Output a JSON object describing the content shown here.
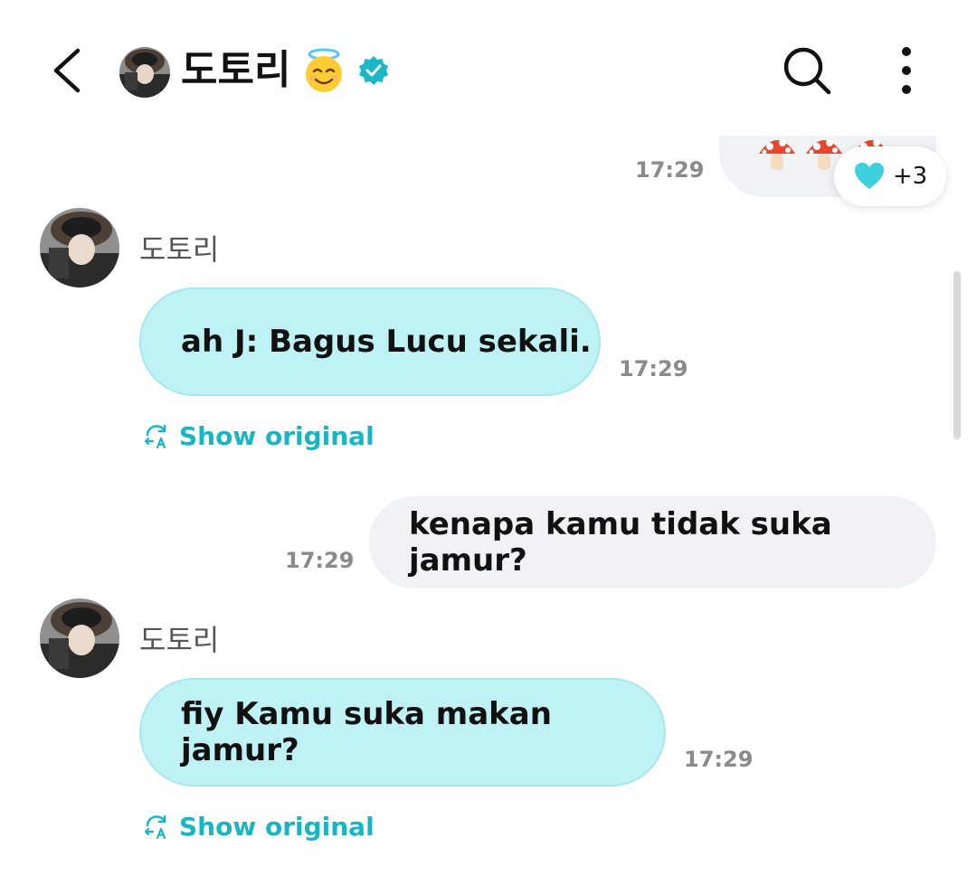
{
  "header": {
    "title": "도토리",
    "back_icon": "chevron-left-icon",
    "emoji": "smiling-face-with-halo",
    "verified_icon": "verified-badge-icon",
    "search_icon": "search-icon",
    "more_icon": "more-vertical-icon"
  },
  "colors": {
    "incoming_bubble": "#bff2f5",
    "outgoing_bubble": "#f1f2f5",
    "accent": "#17b6c4"
  },
  "messages": [
    {
      "direction": "out",
      "content": "mushroom emojis",
      "time": "17:29",
      "reaction": {
        "icon": "heart-icon",
        "count": "+3"
      }
    },
    {
      "direction": "in",
      "sender": "도토리",
      "text": "ah J: Bagus Lucu sekali.",
      "time": "17:29",
      "show_original": "Show original"
    },
    {
      "direction": "out",
      "text": "kenapa kamu tidak suka jamur?",
      "time": "17:29"
    },
    {
      "direction": "in",
      "sender": "도토리",
      "text": "fiy Kamu suka makan jamur?",
      "time": "17:29",
      "show_original": "Show original"
    }
  ]
}
